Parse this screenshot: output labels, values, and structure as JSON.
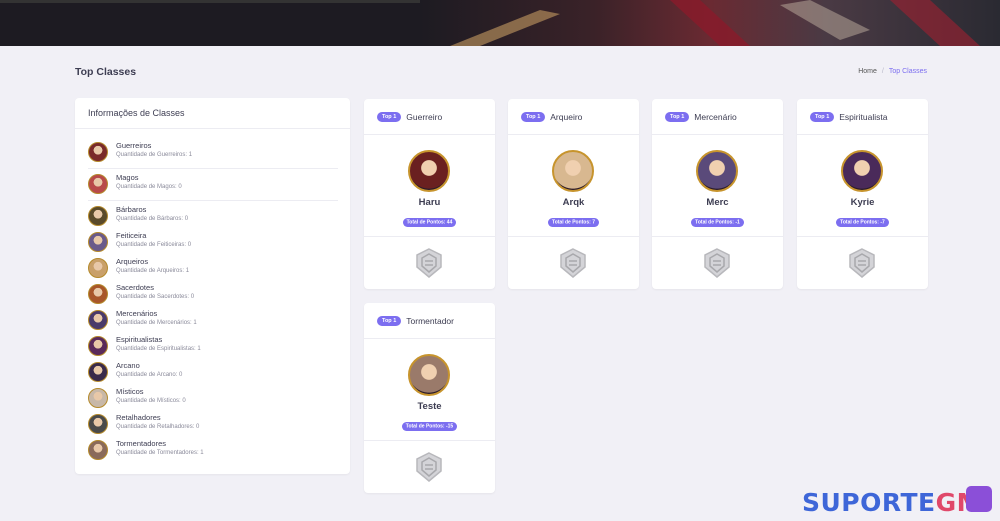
{
  "header": {
    "title": "Top Classes",
    "breadcrumb": {
      "home": "Home",
      "separator": "/",
      "current": "Top Classes"
    }
  },
  "info": {
    "title": "Informações de Classes",
    "classes": [
      {
        "name": "Guerreiros",
        "qty": "Quantidade de Guerreiros: 1",
        "color": "#7a2a2a"
      },
      {
        "name": "Magos",
        "qty": "Quantidade de Magos: 0",
        "color": "#b84a4a"
      },
      {
        "name": "Bárbaros",
        "qty": "Quantidade de Bárbaros: 0",
        "color": "#5a4a2a"
      },
      {
        "name": "Feiticeira",
        "qty": "Quantidade de Feiticeiras: 0",
        "color": "#6a5a8a"
      },
      {
        "name": "Arqueiros",
        "qty": "Quantidade de Arqueiros: 1",
        "color": "#c9a06a"
      },
      {
        "name": "Sacerdotes",
        "qty": "Quantidade de Sacerdotes: 0",
        "color": "#a8562a"
      },
      {
        "name": "Mercenários",
        "qty": "Quantidade de Mercenários: 1",
        "color": "#4a3a6a"
      },
      {
        "name": "Espiritualistas",
        "qty": "Quantidade de Espiritualistas: 1",
        "color": "#5a2a5a"
      },
      {
        "name": "Arcano",
        "qty": "Quantidade de Arcano: 0",
        "color": "#3a2a4a"
      },
      {
        "name": "Místicos",
        "qty": "Quantidade de Místicos: 0",
        "color": "#c8b8a8"
      },
      {
        "name": "Retalhadores",
        "qty": "Quantidade de Retalhadores: 0",
        "color": "#4a4a4a"
      },
      {
        "name": "Tormentadores",
        "qty": "Quantidade de Tormentadores: 1",
        "color": "#8a6a5a"
      }
    ]
  },
  "tops": [
    {
      "badge": "Top 1",
      "class": "Guerreiro",
      "player": "Haru",
      "points": "Total de Pontos: 44",
      "color": "#6a2020"
    },
    {
      "badge": "Top 1",
      "class": "Arqueiro",
      "player": "Arqk",
      "points": "Total de Pontos: 7",
      "color": "#d8b890"
    },
    {
      "badge": "Top 1",
      "class": "Mercenário",
      "player": "Merc",
      "points": "Total de Pontos: -1",
      "color": "#5a4a7a"
    },
    {
      "badge": "Top 1",
      "class": "Espiritualista",
      "player": "Kyrie",
      "points": "Total de Pontos: -7",
      "color": "#4a2a5a"
    },
    {
      "badge": "Top 1",
      "class": "Tormentador",
      "player": "Teste",
      "points": "Total de Pontos: -15",
      "color": "#9a7a6a"
    }
  ],
  "watermark": {
    "part1": "SUPORTE",
    "part2": "GM"
  },
  "colors": {
    "accent": "#7c6ef0",
    "gold": "#c7942d"
  }
}
